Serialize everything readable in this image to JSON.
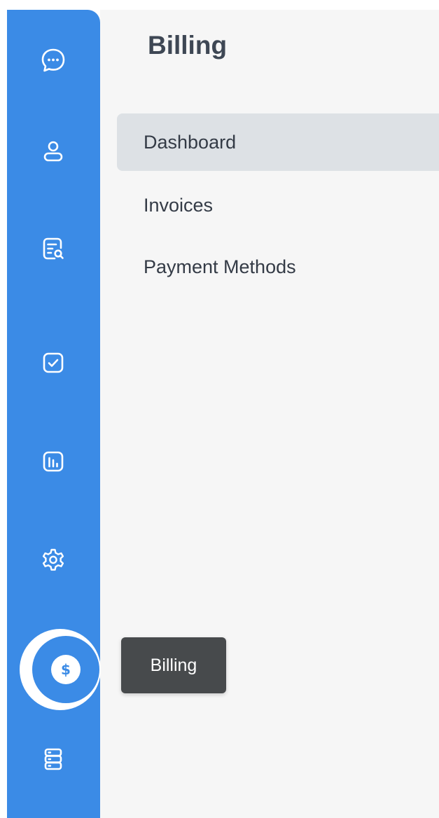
{
  "panel": {
    "title": "Billing",
    "menu_items": [
      {
        "label": "Dashboard",
        "active": true
      },
      {
        "label": "Invoices",
        "active": false
      },
      {
        "label": "Payment Methods",
        "active": false
      }
    ]
  },
  "sidebar": {
    "items": [
      {
        "icon": "chat-bubble-icon"
      },
      {
        "icon": "user-icon"
      },
      {
        "icon": "document-search-icon"
      },
      {
        "icon": "checkbox-icon"
      },
      {
        "icon": "bar-chart-icon"
      },
      {
        "icon": "gear-icon"
      },
      {
        "icon": "dollar-icon",
        "active": true
      },
      {
        "icon": "server-icon"
      }
    ],
    "active_symbol": "$"
  },
  "tooltip": {
    "text": "Billing"
  },
  "colors": {
    "sidebar": "#3b8be6",
    "panel_bg": "#f6f6f6",
    "active_item_bg": "#dde1e5",
    "tooltip_bg": "#474a4c",
    "title_text": "#3e4754"
  }
}
